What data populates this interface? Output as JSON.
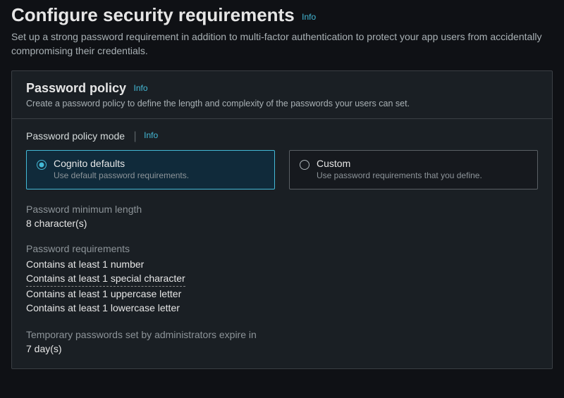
{
  "heading": {
    "title": "Configure security requirements",
    "info": "Info",
    "description": "Set up a strong password requirement in addition to multi-factor authentication to protect your app users from accidentally compromising their credentials."
  },
  "panel": {
    "title": "Password policy",
    "info": "Info",
    "description": "Create a password policy to define the length and complexity of the passwords your users can set."
  },
  "mode": {
    "label": "Password policy mode",
    "info": "Info",
    "options": [
      {
        "title": "Cognito defaults",
        "desc": "Use default password requirements."
      },
      {
        "title": "Custom",
        "desc": "Use password requirements that you define."
      }
    ]
  },
  "minLength": {
    "label": "Password minimum length",
    "value": "8 character(s)"
  },
  "requirements": {
    "label": "Password requirements",
    "items": [
      "Contains at least 1 number",
      "Contains at least 1 special character",
      "Contains at least 1 uppercase letter",
      "Contains at least 1 lowercase letter"
    ]
  },
  "tempPassword": {
    "label": "Temporary passwords set by administrators expire in",
    "value": "7 day(s)"
  }
}
